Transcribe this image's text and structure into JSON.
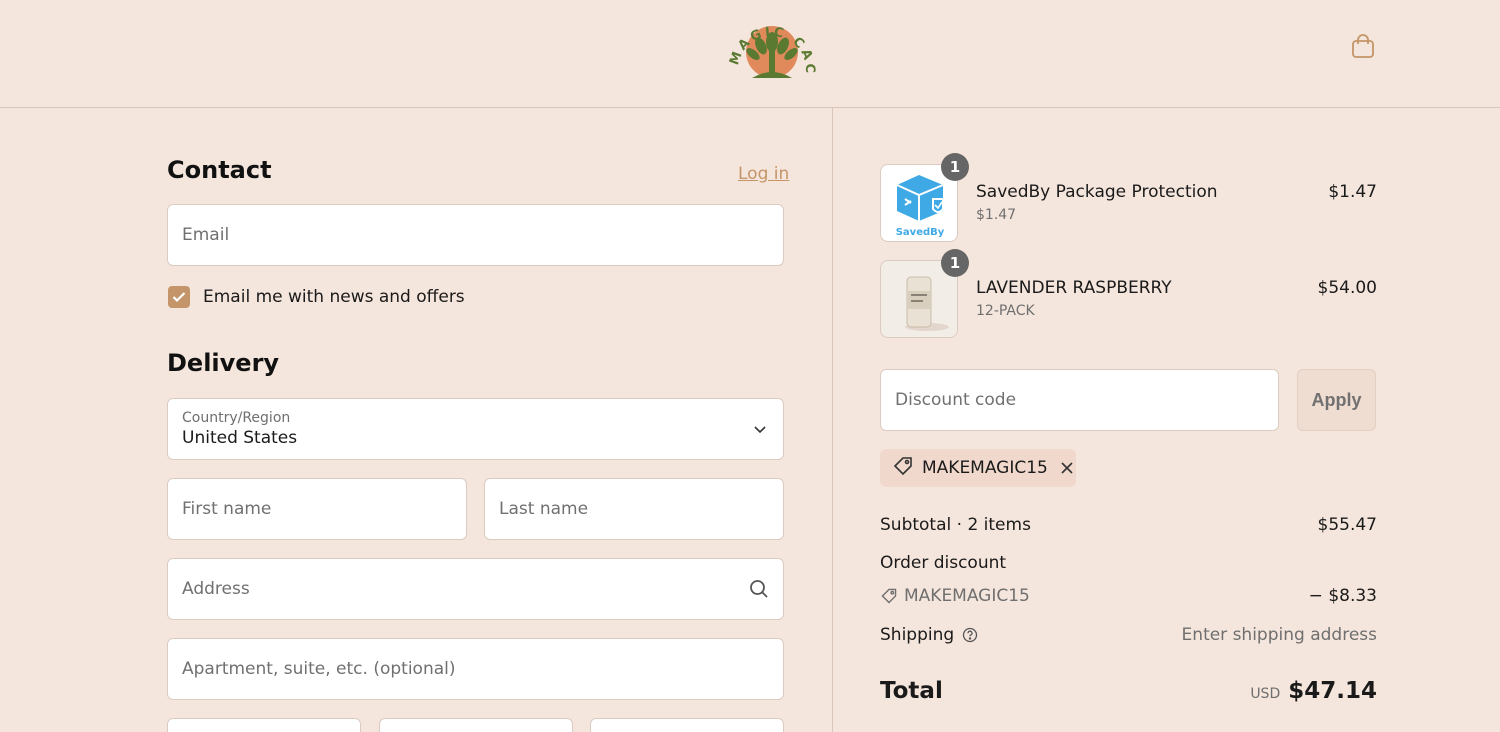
{
  "header": {
    "logo_text": "MAGIC CACTUS",
    "bag_icon": "shopping-bag-icon"
  },
  "contact": {
    "title": "Contact",
    "login_label": "Log in",
    "email_placeholder": "Email",
    "newsletter_label": "Email me with news and offers",
    "newsletter_checked": true
  },
  "delivery": {
    "title": "Delivery",
    "country_label": "Country/Region",
    "country_value": "United States",
    "first_name_placeholder": "First name",
    "last_name_placeholder": "Last name",
    "address_placeholder": "Address",
    "apartment_placeholder": "Apartment, suite, etc. (optional)"
  },
  "cart": {
    "items": [
      {
        "name": "SavedBy Package Protection",
        "subtitle": "$1.47",
        "price": "$1.47",
        "qty": "1",
        "brand_text": "SavedBy"
      },
      {
        "name": "LAVENDER RASPBERRY",
        "subtitle": "12-PACK",
        "price": "$54.00",
        "qty": "1"
      }
    ],
    "discount_placeholder": "Discount code",
    "apply_label": "Apply",
    "applied_code": "MAKEMAGIC15"
  },
  "summary": {
    "subtotal_label": "Subtotal · 2 items",
    "subtotal_value": "$55.47",
    "order_discount_label": "Order discount",
    "discount_code": "MAKEMAGIC15",
    "discount_value": "− $8.33",
    "shipping_label": "Shipping",
    "shipping_value": "Enter shipping address",
    "total_label": "Total",
    "currency": "USD",
    "total_value": "$47.14"
  },
  "colors": {
    "background": "#f5e6dd",
    "accent": "#c49568",
    "logo_orange": "#e08a5c",
    "logo_green": "#5a7a32"
  }
}
